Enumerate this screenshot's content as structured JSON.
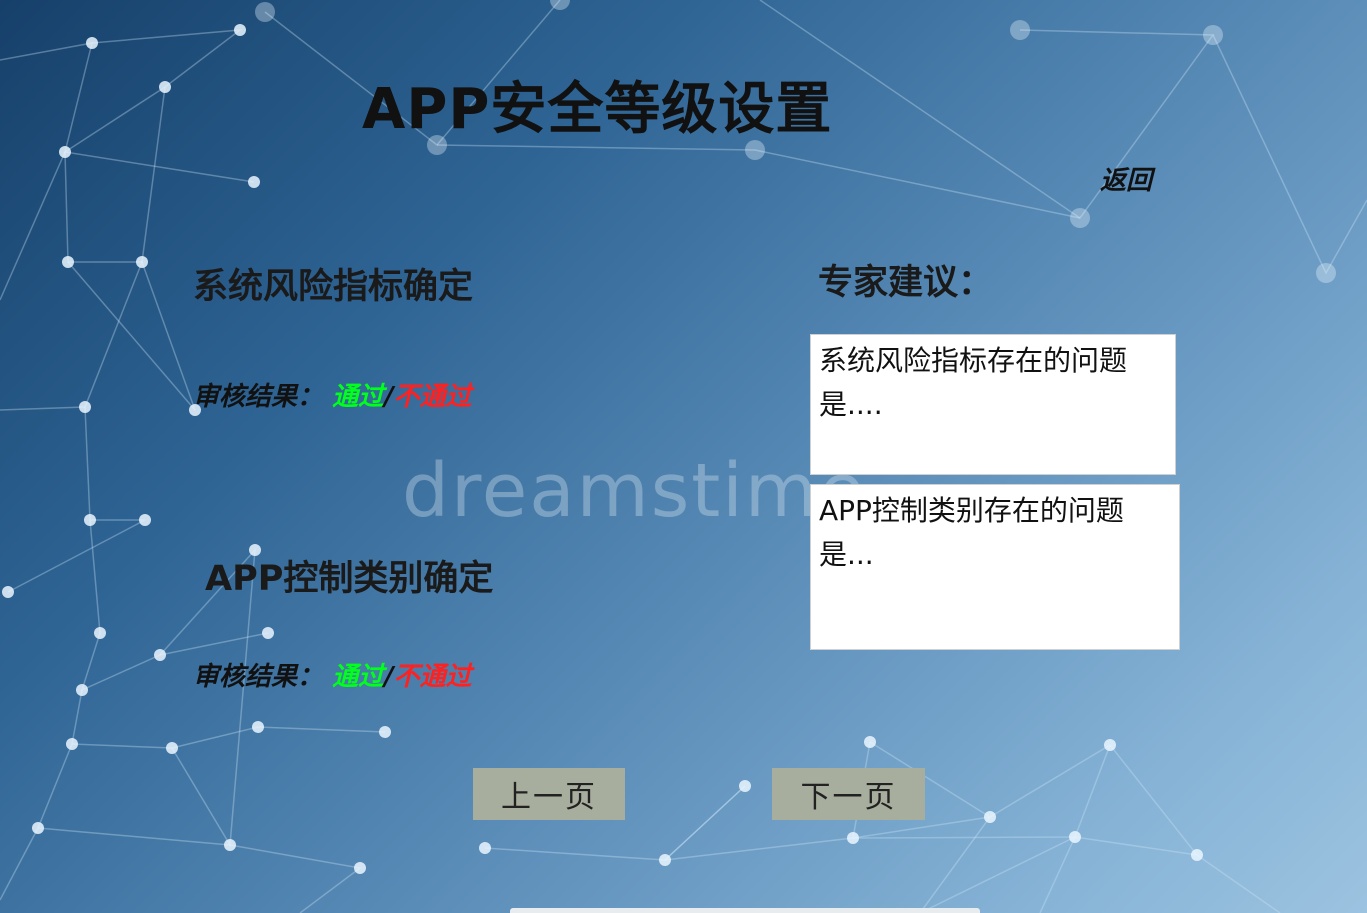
{
  "page": {
    "title": "APP安全等级设置",
    "back_link": "返回"
  },
  "system_risk": {
    "heading": "系统风险指标确定",
    "result_label": "审核结果：",
    "pass_label": "通过",
    "separator": "/",
    "fail_label": "不通过"
  },
  "app_control": {
    "heading": "APP控制类别确定",
    "result_label": "审核结果：",
    "pass_label": "通过",
    "separator": "/",
    "fail_label": "不通过"
  },
  "expert": {
    "heading": "专家建议：",
    "system_risk_advice": "系统风险指标存在的问题是....",
    "app_control_advice": "APP控制类别存在的问题是..."
  },
  "navigation": {
    "prev_label": "上一页",
    "next_label": "下一页"
  },
  "colors": {
    "pass": "#00ff1a",
    "fail": "#ff2020",
    "button_bg": "#a8ae9e"
  },
  "background": {
    "watermark": "dreamstime"
  }
}
